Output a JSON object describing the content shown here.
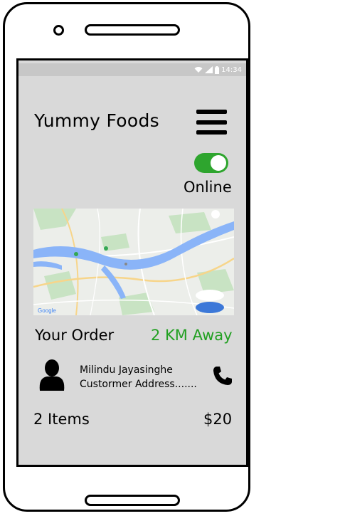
{
  "status_bar": {
    "time": "14:34"
  },
  "header": {
    "title": "Yummy Foods",
    "menu_icon": "hamburger-menu-icon"
  },
  "availability": {
    "online": true,
    "label": "Online",
    "toggle_color": "#2ea52e"
  },
  "map": {
    "icon": "map-thumbnail"
  },
  "order": {
    "heading": "Your Order",
    "distance": "2 KM Away",
    "distance_color": "#22a022",
    "customer_name": "Milindu Jayasinghe",
    "customer_address": "Custormer Address.......",
    "items": "2 Items",
    "price": "$20"
  }
}
